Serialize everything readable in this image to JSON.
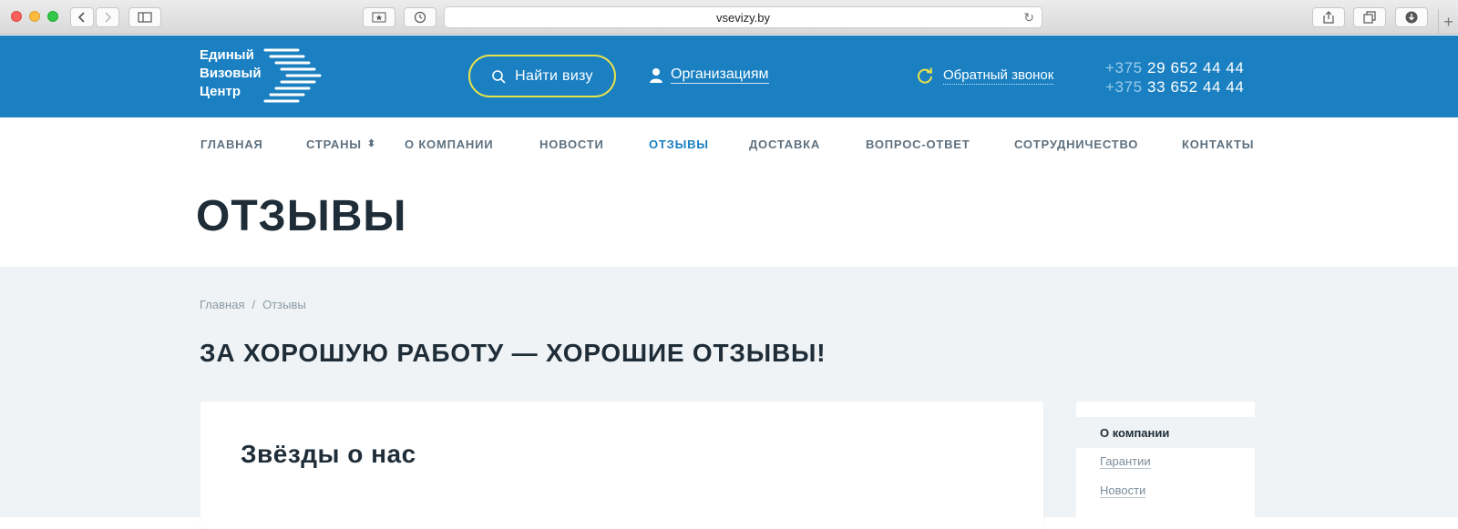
{
  "browser": {
    "url": "vsevizy.by",
    "icons": [
      "back-icon",
      "forward-icon",
      "sidebar-icon",
      "bookmark-icon",
      "history-icon",
      "reload-icon",
      "share-icon",
      "tabs-icon",
      "download-icon",
      "new-tab-icon"
    ]
  },
  "header": {
    "logo_lines": [
      "Единый",
      "Визовый",
      "Центр"
    ],
    "find_visa": "Найти визу",
    "organizations": "Организациям",
    "callback": "Обратный звонок",
    "phones": [
      {
        "code": "+375",
        "number": "29 652 44 44"
      },
      {
        "code": "+375",
        "number": "33 652 44 44"
      }
    ],
    "colors": {
      "background": "#1a80c2",
      "accent": "#e8e24c"
    }
  },
  "nav": {
    "items": [
      {
        "label": "ГЛАВНАЯ"
      },
      {
        "label": "СТРАНЫ"
      },
      {
        "label": "О КОМПАНИИ"
      },
      {
        "label": "НОВОСТИ"
      },
      {
        "label": "ОТЗЫВЫ"
      },
      {
        "label": "ДОСТАВКА"
      },
      {
        "label": "ВОПРОС-ОТВЕТ"
      },
      {
        "label": "СОТРУДНИЧЕСТВО"
      },
      {
        "label": "КОНТАКТЫ"
      }
    ],
    "active_index": 4
  },
  "page": {
    "title": "ОТЗЫВЫ",
    "breadcrumb": [
      "Главная",
      "Отзывы"
    ],
    "breadcrumb_separator": "/",
    "heading": "ЗА ХОРОШУЮ РАБОТУ — ХОРОШИЕ ОТЗЫВЫ!",
    "card_title": "Звёзды о нас"
  },
  "sidebar": {
    "items": [
      {
        "label": "О компании"
      },
      {
        "label": "Гарантии"
      },
      {
        "label": "Новости"
      }
    ],
    "active_index": 0
  }
}
